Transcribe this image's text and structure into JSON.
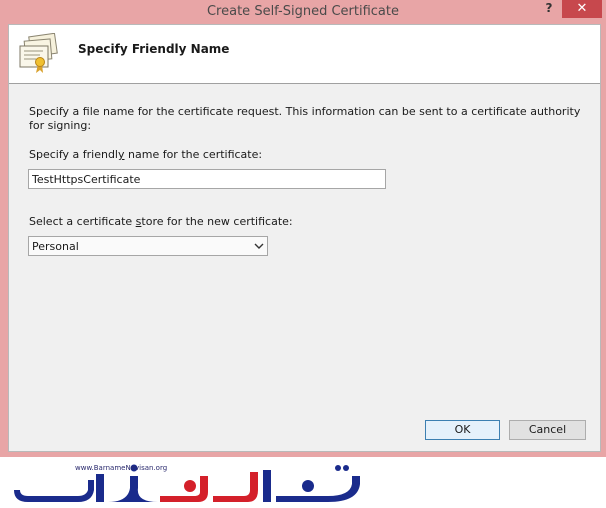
{
  "window": {
    "title": "Create Self-Signed Certificate",
    "help_label": "?",
    "close_label": "✕"
  },
  "header": {
    "title": "Specify Friendly Name",
    "icon": "certificate-icon"
  },
  "content": {
    "description": "Specify a file name for the certificate request.  This information can be sent to a certificate authority for signing:",
    "friendly_name_label_a": "Specify a friendl",
    "friendly_name_label_u": "y",
    "friendly_name_label_b": " name for the certificate:",
    "friendly_name_value": "TestHttpsCertificate",
    "store_label_a": "Select a certificate ",
    "store_label_u": "s",
    "store_label_b": "tore for the new certificate:",
    "store_value": "Personal"
  },
  "buttons": {
    "ok": "OK",
    "cancel": "Cancel"
  },
  "watermark": {
    "url": "www.BarnameNevisan.org"
  },
  "colors": {
    "frame": "#e8a5a6",
    "close": "#c7484d",
    "logo_blue": "#1a2b8c",
    "logo_red": "#d4202a"
  }
}
